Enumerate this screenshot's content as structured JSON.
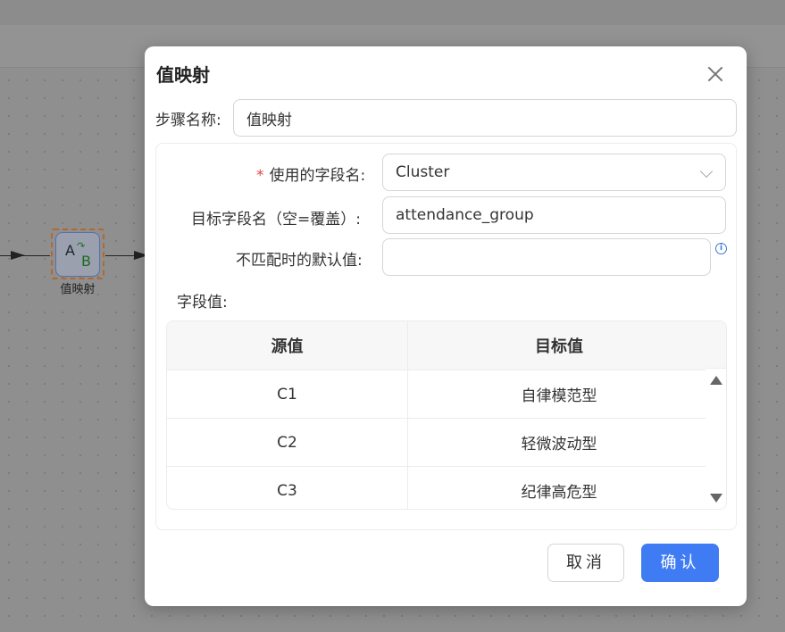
{
  "canvas": {
    "node": {
      "label": "值映射",
      "icon_a": "A",
      "icon_b": "B",
      "icon_name": "value-map-icon"
    }
  },
  "dialog": {
    "title": "值映射",
    "close_icon": "close-icon",
    "step_name": {
      "label": "步骤名称:",
      "value": "值映射"
    },
    "source_field": {
      "required_mark": "*",
      "label": "使用的字段名:",
      "value": "Cluster"
    },
    "target_field": {
      "label": "目标字段名（空=覆盖）:",
      "value": "attendance_group"
    },
    "default_value": {
      "label": "不匹配时的默认值:",
      "value": ""
    },
    "info_icon": "info-icon",
    "field_values_label": "字段值:",
    "table": {
      "headers": [
        "源值",
        "目标值"
      ],
      "rows": [
        [
          "C1",
          "自律模范型"
        ],
        [
          "C2",
          "轻微波动型"
        ],
        [
          "C3",
          "纪律高危型"
        ]
      ]
    },
    "buttons": {
      "cancel": "取消",
      "ok": "确认"
    }
  },
  "colors": {
    "primary": "#3f7cf4",
    "required": "#e0463e",
    "overlay": "#8f8f8f"
  }
}
